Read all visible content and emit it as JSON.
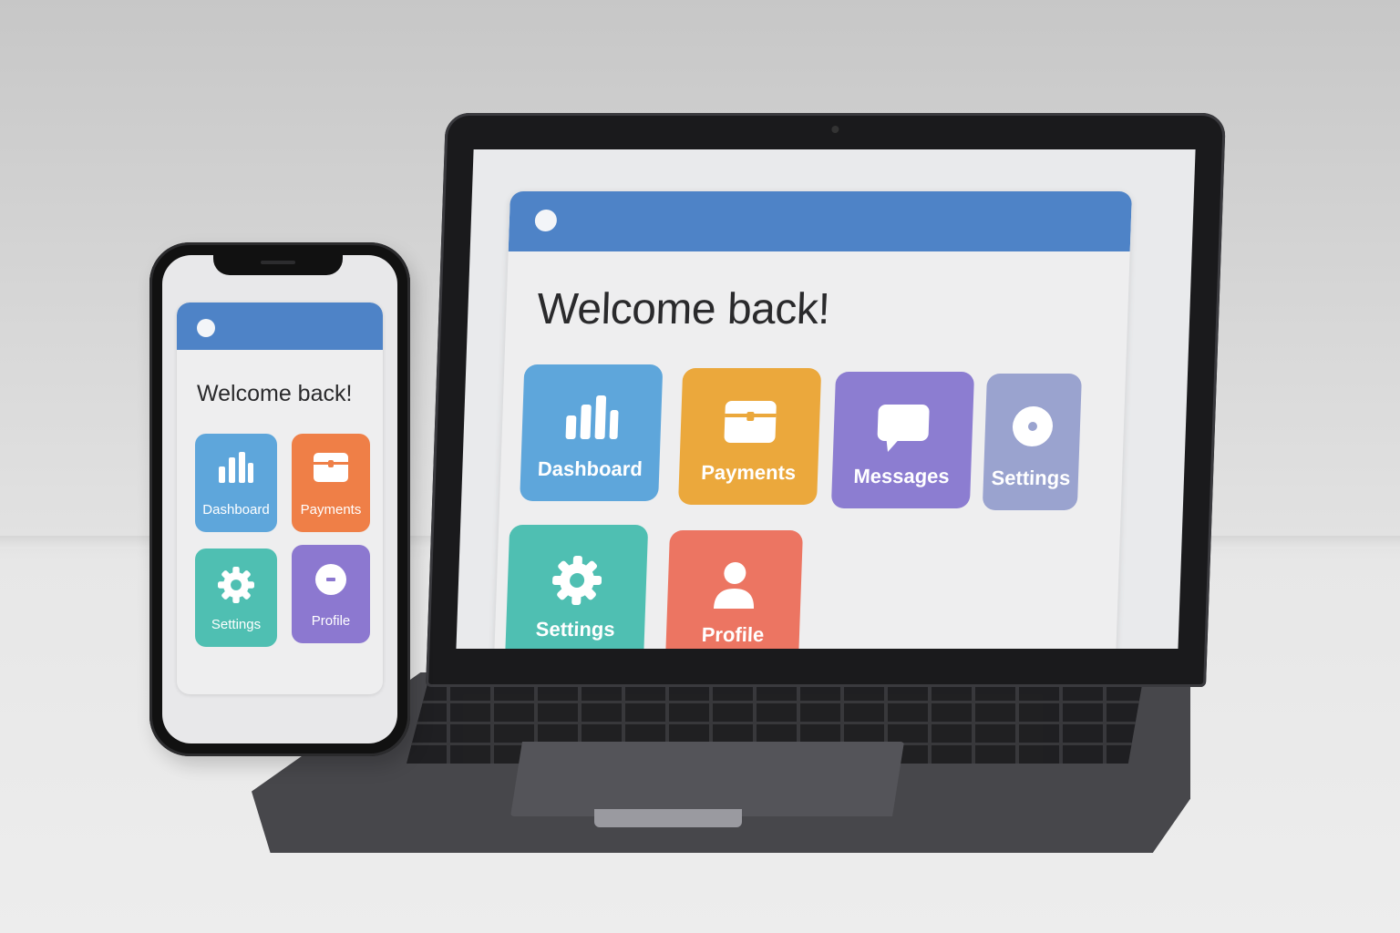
{
  "laptop": {
    "title": "Welcome back!",
    "tiles": [
      {
        "label": "Dashboard",
        "icon": "bar-chart-icon",
        "color": "#5ea6db"
      },
      {
        "label": "Payments",
        "icon": "wallet-icon",
        "color": "#eba83c"
      },
      {
        "label": "Messages",
        "icon": "chat-bubble-icon",
        "color": "#8c7dd1"
      },
      {
        "label": "Settings",
        "icon": "disc-icon",
        "color": "#9aa3cf"
      },
      {
        "label": "Settings",
        "icon": "gear-icon",
        "color": "#4fbfb2"
      },
      {
        "label": "Profile",
        "icon": "user-icon",
        "color": "#ec7562"
      }
    ]
  },
  "phone": {
    "title": "Welcome back!",
    "tiles": [
      {
        "label": "Dashboard",
        "icon": "bar-chart-icon",
        "color": "#5ea6db"
      },
      {
        "label": "Payments",
        "icon": "wallet-icon",
        "color": "#ef7f47"
      },
      {
        "label": "Settings",
        "icon": "gear-icon",
        "color": "#4fbfb2"
      },
      {
        "label": "Profile",
        "icon": "minus-circle-icon",
        "color": "#8c78d0"
      }
    ]
  },
  "colors": {
    "header": "#4e83c7",
    "background": "#e6e6e6"
  }
}
